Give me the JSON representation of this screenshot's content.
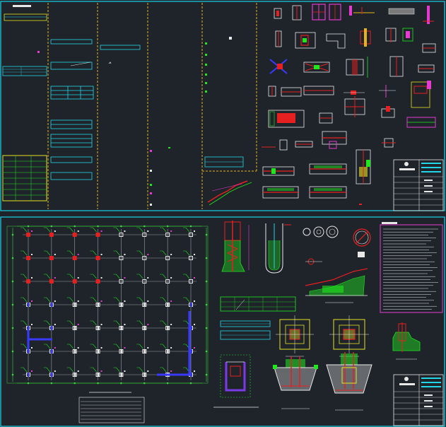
{
  "sheets": [
    {
      "id": "sheet-top",
      "label": ""
    },
    {
      "id": "sheet-bottom",
      "label": ""
    }
  ],
  "plan": {
    "caption": "",
    "columns": 8,
    "rows": 7
  },
  "colors": {
    "background": "#1f242b",
    "sheet_frame": "#19d3e6",
    "column_divider": "#e6b21a",
    "grid_line": "#9aa0a6",
    "dimension": "#3ad53a",
    "rebar": "#e62020",
    "detail_fill": "#1fe61f",
    "magenta": "#e63ad2",
    "cyan": "#22d6e6",
    "yellow": "#e6e020",
    "white": "#e8e8e8",
    "blue": "#3a3aff",
    "purple": "#7a3ae6"
  }
}
